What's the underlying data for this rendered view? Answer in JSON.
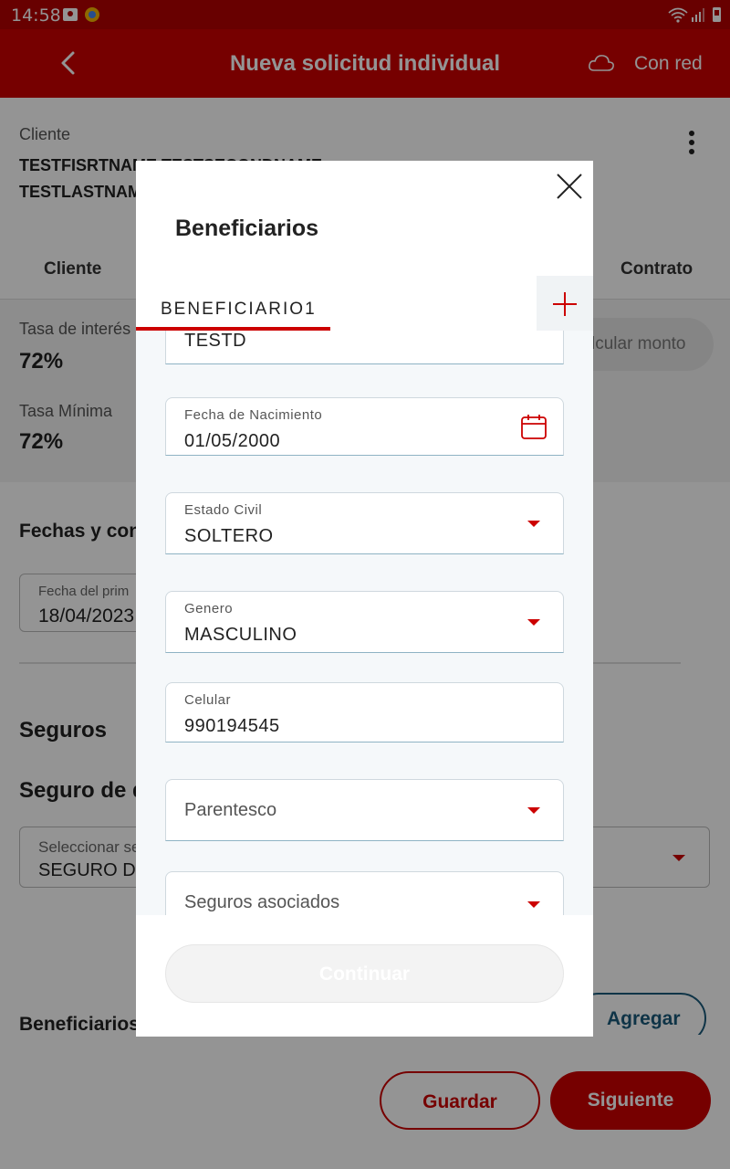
{
  "status_bar": {
    "time": "14:58"
  },
  "app_bar": {
    "title": "Nueva solicitud individual",
    "network_status": "Con red"
  },
  "client": {
    "label": "Cliente",
    "name": "TESTFISRTNAME TESTSECONDNAME TESTLASTNAME"
  },
  "tabs": {
    "left": "Cliente",
    "right": "Contrato"
  },
  "rates": {
    "interest_label": "Tasa de interés",
    "interest_value": "72%",
    "min_label": "Tasa Mínima",
    "min_value": "72%",
    "calc_button": "lcular monto"
  },
  "schedule": {
    "heading": "Fechas y con",
    "first_date_label": "Fecha del prim",
    "first_date_value": "18/04/2023"
  },
  "insurance": {
    "heading": "Seguros",
    "subheading": "Seguro de d",
    "select_label": "Seleccionar se",
    "select_value": "SEGURO DE"
  },
  "beneficiaries_section": {
    "heading": "Beneficiarios",
    "add_button": "Agregar"
  },
  "footer": {
    "save": "Guardar",
    "next": "Siguiente"
  },
  "modal": {
    "title": "Beneficiarios",
    "tab_label": "BENEFICIARIO1",
    "fields": {
      "partial_value": "TESTD",
      "birth_label": "Fecha de Nacimiento",
      "birth_value": "01/05/2000",
      "civil_label": "Estado Civil",
      "civil_value": "SOLTERO",
      "gender_label": "Genero",
      "gender_value": "MASCULINO",
      "phone_label": "Celular",
      "phone_value": "990194545",
      "relationship_placeholder": "Parentesco",
      "insurance_placeholder": "Seguros asociados"
    },
    "continue_button": "Continuar"
  },
  "colors": {
    "brand_red": "#cc0000",
    "status_red": "#b30000",
    "link_blue": "#1a5a7a"
  },
  "icons": [
    "back-arrow-icon",
    "cloud-icon",
    "kebab-icon",
    "close-icon",
    "plus-icon",
    "calendar-icon",
    "dropdown-arrow-icon"
  ]
}
